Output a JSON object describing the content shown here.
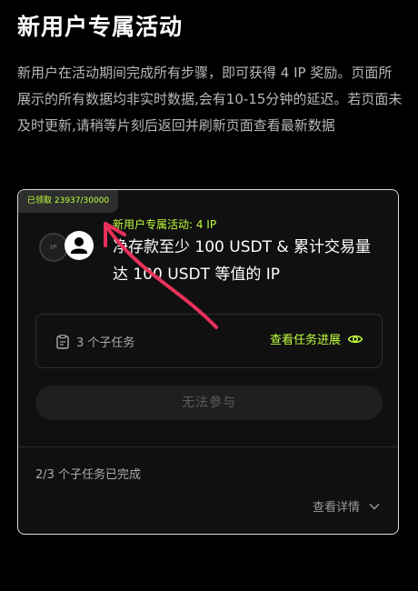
{
  "page": {
    "title": "新用户专属活动",
    "description": "新用户在活动期间完成所有步骤，即可获得 4 IP 奖励。页面所展示的所有数据均非实时数据,会有10-15分钟的延迟。若页面未及时更新,请稍等片刻后返回并刷新页面查看最新数据"
  },
  "card": {
    "claimed_badge": "已领取 23937/30000",
    "medal_text": "IP",
    "task_label": "新用户专属活动: 4 IP",
    "task_description": "净存款至少 100 USDT & 累计交易量达 100 USDT 等值的 IP",
    "subtask_count": "3 个子任务",
    "view_progress": "查看任务进展",
    "join_button": "无法参与",
    "completed_status": "2/3 个子任务已完成",
    "view_details": "查看详情"
  },
  "colors": {
    "accent": "#c0ff3e",
    "annotation_arrow": "#e8315a"
  }
}
